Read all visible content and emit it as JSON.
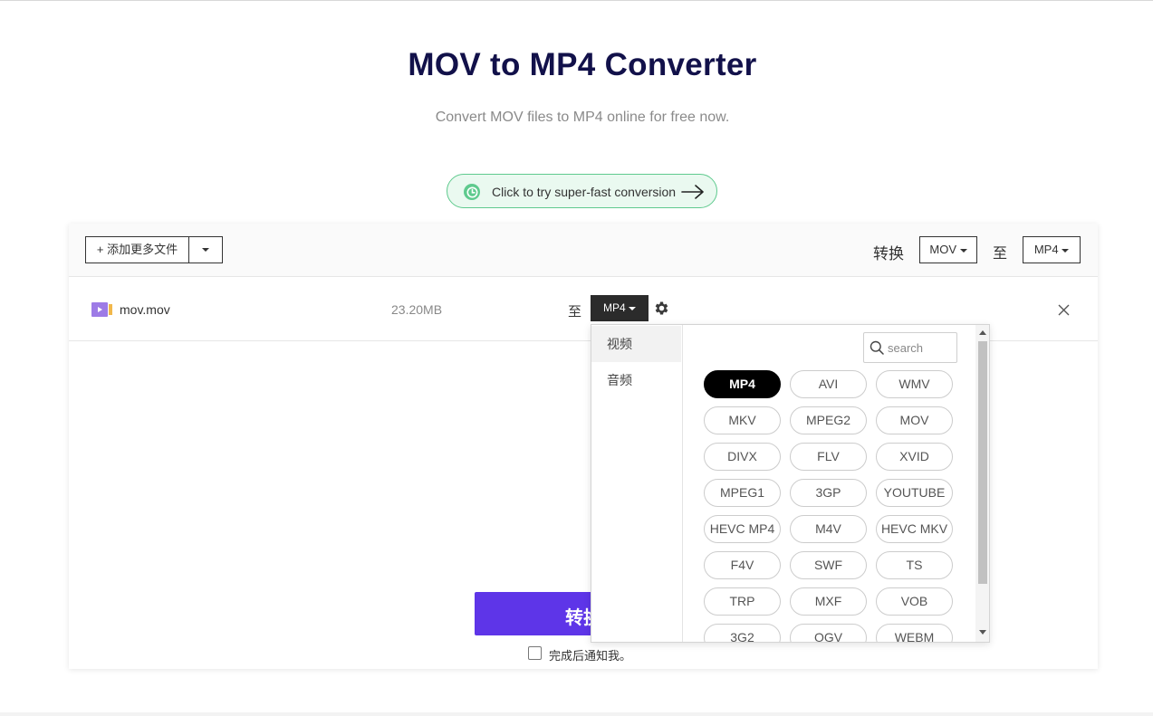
{
  "page": {
    "title": "MOV to MP4 Converter",
    "subtitle": "Convert MOV files to MP4 online for free now."
  },
  "fast_conversion": {
    "label": "Click to try super-fast conversion",
    "icon": "clock-icon",
    "accent_color": "#5fca8e"
  },
  "toolbar": {
    "add_files_label": "+ 添加更多文件",
    "convert_label": "转换",
    "from_format": "MOV",
    "to_label": "至",
    "to_format": "MP4"
  },
  "file": {
    "name": "mov.mov",
    "size": "23.20MB",
    "to_label": "至",
    "target_format": "MP4",
    "icon": "video-file-icon"
  },
  "convert_button": {
    "label": "转换",
    "color": "#5e35e8"
  },
  "notify": {
    "label": "完成后通知我。",
    "checked": false
  },
  "format_dropdown": {
    "categories": [
      "视频",
      "音频"
    ],
    "active_category": "视频",
    "search_placeholder": "search",
    "formats": [
      "MP4",
      "AVI",
      "WMV",
      "MKV",
      "MPEG2",
      "MOV",
      "DIVX",
      "FLV",
      "XVID",
      "MPEG1",
      "3GP",
      "YOUTUBE",
      "HEVC MP4",
      "M4V",
      "HEVC MKV",
      "F4V",
      "SWF",
      "TS",
      "TRP",
      "MXF",
      "VOB",
      "3G2",
      "OGV",
      "WEBM"
    ],
    "selected_format": "MP4"
  }
}
